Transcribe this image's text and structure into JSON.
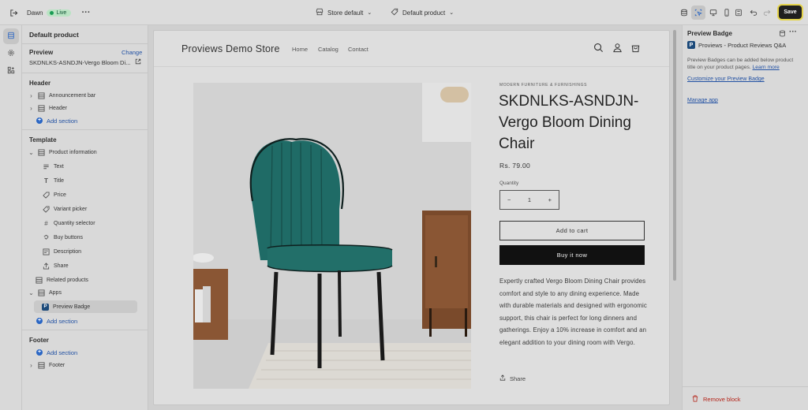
{
  "topbar": {
    "theme_name": "Dawn",
    "live_label": "Live",
    "store_select": "Store default",
    "template_select": "Default product",
    "save_label": "Save"
  },
  "sidebar": {
    "title": "Default product",
    "preview_label": "Preview",
    "change_label": "Change",
    "preview_value": "SKDNLKS-ASNDJN-Vergo Bloom Di...",
    "header_section": "Header",
    "header_items": [
      "Announcement bar",
      "Header"
    ],
    "add_section": "Add section",
    "template_section": "Template",
    "product_information": "Product information",
    "product_blocks": [
      "Text",
      "Title",
      "Price",
      "Variant picker",
      "Quantity selector",
      "Buy buttons",
      "Description",
      "Share"
    ],
    "related_products": "Related products",
    "apps": "Apps",
    "preview_badge": "Preview Badge",
    "footer_section": "Footer",
    "footer_item": "Footer"
  },
  "store": {
    "name": "Proviews Demo Store",
    "nav": [
      "Home",
      "Catalog",
      "Contact"
    ],
    "vendor": "MODERN FURNITURE & FURNISHINGS",
    "product_title": "SKDNLKS-ASNDJN-Vergo Bloom Dining Chair",
    "price": "Rs. 79.00",
    "quantity_label": "Quantity",
    "quantity_value": "1",
    "minus": "−",
    "plus": "+",
    "add_to_cart": "Add to cart",
    "buy_now": "Buy it now",
    "description": "Expertly crafted Vergo Bloom Dining Chair provides comfort and style to any dining experience. Made with durable materials and designed with ergonomic support, this chair is perfect for long dinners and gatherings. Enjoy a 10% increase in comfort and an elegant addition to your dining room with Vergo.",
    "share": "Share"
  },
  "right_panel": {
    "title": "Preview Badge",
    "app_name": "Proviews - Product Reviews Q&A",
    "info_text": "Preview Badges can be added below product title on your product pages.",
    "learn_more": "Learn more",
    "customize_link": "Customize your Preview Badge",
    "manage_app": "Manage app",
    "remove_block": "Remove block"
  },
  "colors": {
    "accent_link": "#2251a3",
    "live_green": "#1a9c54",
    "chair_teal": "#1f6b66",
    "danger": "#b42318"
  }
}
